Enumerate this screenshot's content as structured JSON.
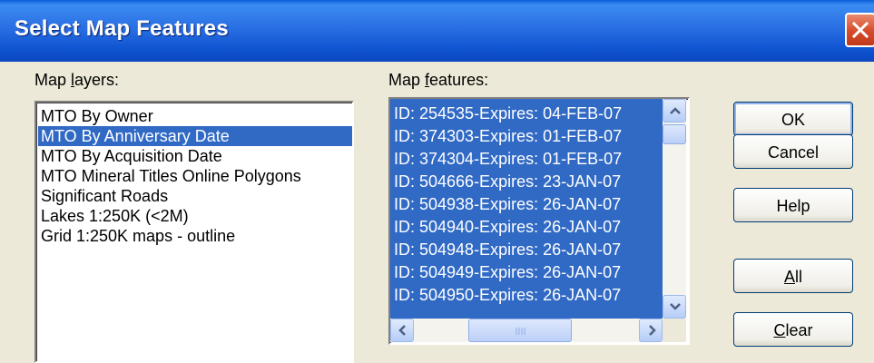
{
  "window": {
    "title": "Select Map Features",
    "close_icon": "close-icon"
  },
  "layers_panel": {
    "label": "Map layers:",
    "items": [
      {
        "label": "MTO By Owner",
        "selected": false
      },
      {
        "label": "MTO By Anniversary Date",
        "selected": true
      },
      {
        "label": "MTO By Acquisition Date",
        "selected": false
      },
      {
        "label": "MTO Mineral Titles Online Polygons",
        "selected": false
      },
      {
        "label": "Significant Roads",
        "selected": false
      },
      {
        "label": "Lakes 1:250K (<2M)",
        "selected": false
      },
      {
        "label": "Grid 1:250K maps - outline",
        "selected": false
      }
    ]
  },
  "features_panel": {
    "label": "Map features:",
    "items": [
      "ID: 254535-Expires: 04-FEB-07",
      "ID: 374303-Expires: 01-FEB-07",
      "ID: 374304-Expires: 01-FEB-07",
      "ID: 504666-Expires: 23-JAN-07",
      "ID: 504938-Expires: 26-JAN-07",
      "ID: 504940-Expires: 26-JAN-07",
      "ID: 504948-Expires: 26-JAN-07",
      "ID: 504949-Expires: 26-JAN-07",
      "ID: 504950-Expires: 26-JAN-07"
    ],
    "selection_color": "#316ac5"
  },
  "buttons": {
    "ok": "OK",
    "cancel": "Cancel",
    "help": "Help",
    "all": "All",
    "clear": "Clear"
  }
}
